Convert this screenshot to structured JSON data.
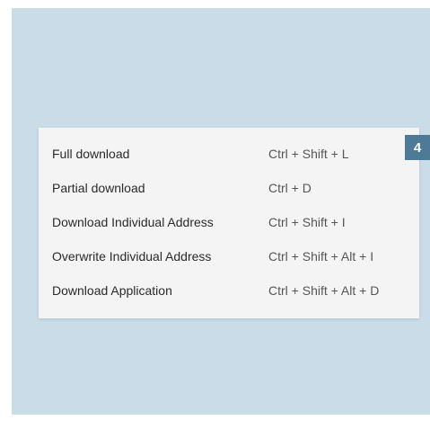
{
  "menu": {
    "items": [
      {
        "label": "Full download",
        "shortcut": "Ctrl + Shift + L"
      },
      {
        "label": "Partial download",
        "shortcut": "Ctrl + D"
      },
      {
        "label": "Download Individual Address",
        "shortcut": "Ctrl + Shift + I"
      },
      {
        "label": "Overwrite Individual Address",
        "shortcut": "Ctrl + Shift + Alt + I"
      },
      {
        "label": "Download Application",
        "shortcut": "Ctrl + Shift + Alt + D"
      }
    ]
  },
  "callout": {
    "number": "4",
    "color": "#4d7a96"
  },
  "colors": {
    "backdrop": "#c9dce8",
    "menu_bg": "#f4f4f4"
  }
}
